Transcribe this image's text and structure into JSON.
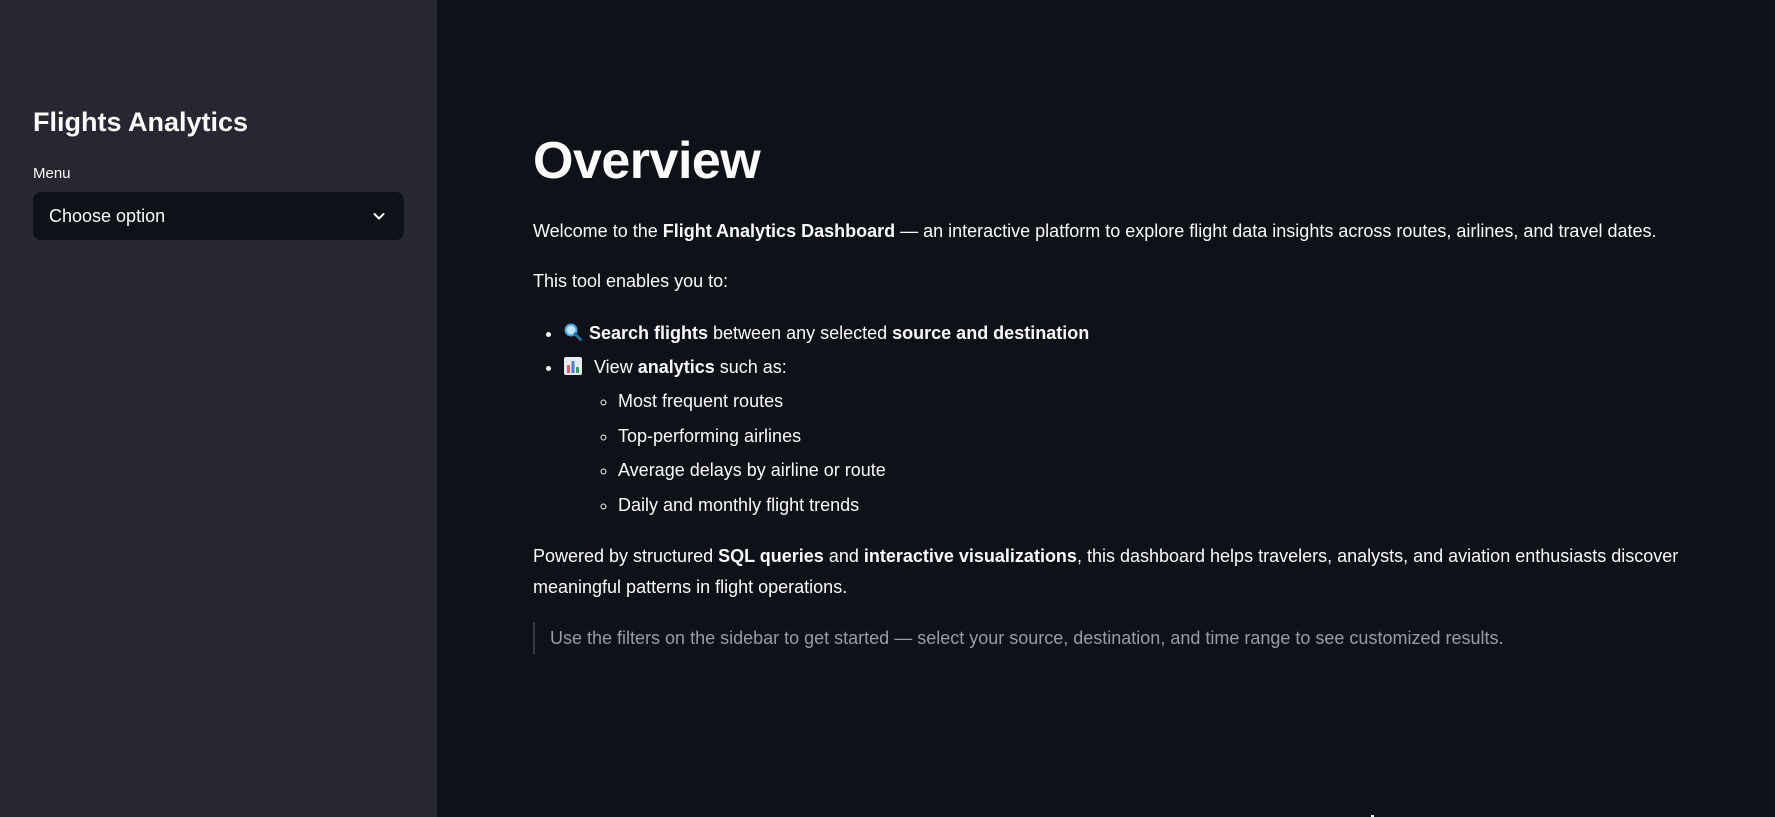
{
  "sidebar": {
    "title": "Flights Analytics",
    "menu_label": "Menu",
    "select_value": "Choose option"
  },
  "main": {
    "title": "Overview",
    "intro": {
      "pre": "Welcome to the ",
      "bold": "Flight Analytics Dashboard",
      "post": " — an interactive platform to explore flight data insights across routes, airlines, and travel dates."
    },
    "enables": "This tool enables you to:",
    "bullet_search": {
      "icon": "magnifier-icon",
      "bold1": "Search flights",
      "mid": " between any selected ",
      "bold2": "source and destination"
    },
    "bullet_view": {
      "icon": "bar-chart-icon",
      "pre": " View ",
      "bold": "analytics",
      "post": " such as:"
    },
    "sub_items": [
      "Most frequent routes",
      "Top-performing airlines",
      "Average delays by airline or route",
      "Daily and monthly flight trends"
    ],
    "powered": {
      "pre": "Powered by structured ",
      "bold1": "SQL queries",
      "mid": " and ",
      "bold2": "interactive visualizations",
      "post": ", this dashboard helps travelers, analysts, and aviation enthusiasts discover meaningful patterns in flight operations."
    },
    "quote": "Use the filters on the sidebar to get started — select your source, destination, and time range to see customized results."
  },
  "colors": {
    "sidebar_bg": "#262730",
    "main_bg": "#0e1117",
    "text": "#fafafa",
    "muted_text": "#9a9ca3"
  }
}
